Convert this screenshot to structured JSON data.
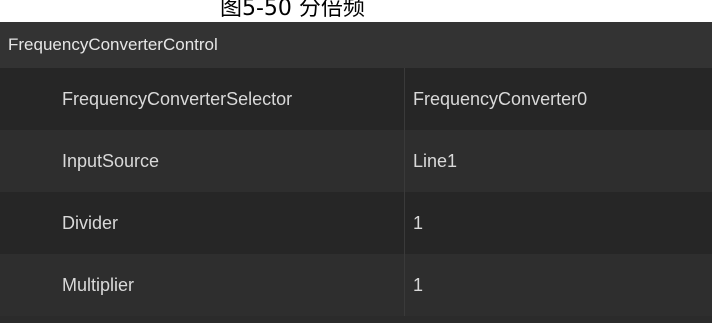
{
  "caption": "图5-50  分倍频",
  "group": {
    "title": "FrequencyConverterControl"
  },
  "rows": [
    {
      "name": "FrequencyConverterSelector",
      "value": "FrequencyConverter0"
    },
    {
      "name": "InputSource",
      "value": "Line1"
    },
    {
      "name": "Divider",
      "value": "1"
    },
    {
      "name": "Multiplier",
      "value": "1"
    }
  ]
}
